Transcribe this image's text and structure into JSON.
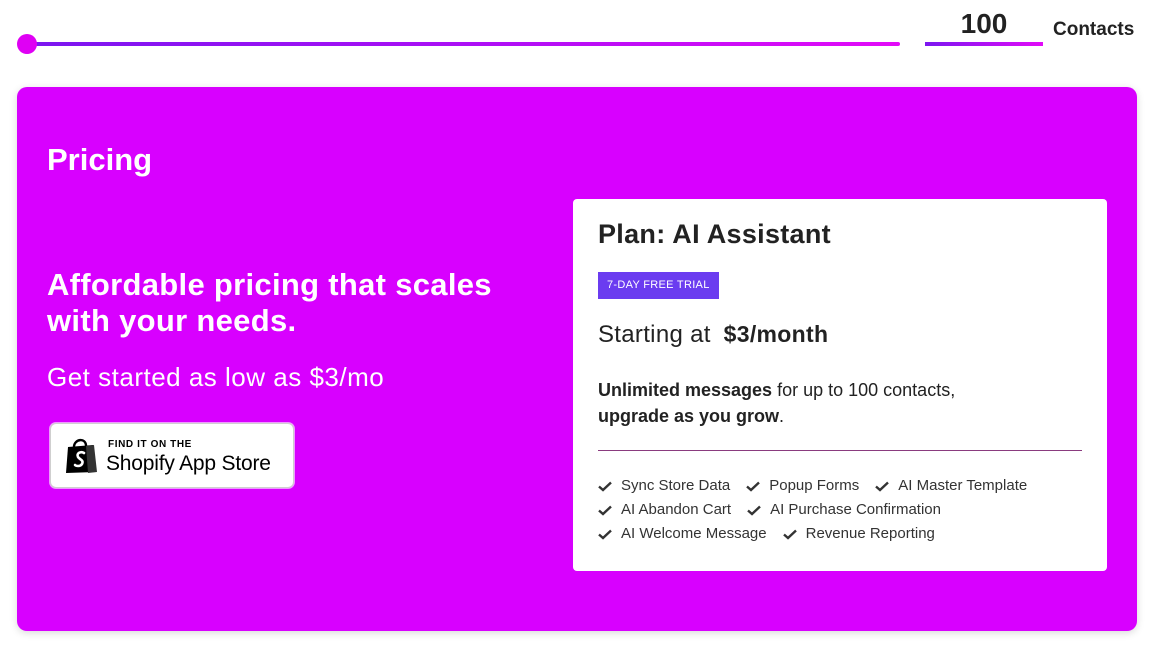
{
  "slider": {
    "value": 100,
    "value_text": "100",
    "unit_label": "Contacts",
    "fill_fraction": 0.0,
    "accent_start": "#7a16f0",
    "accent_end": "#e30af8"
  },
  "pricing": {
    "title": "Pricing",
    "headline": "Affordable pricing that scales with your needs.",
    "subline": "Get started as low as $3/mo",
    "background": "#d800ff",
    "store_badge": {
      "icon": "shopping-bag-icon",
      "small_text": "FIND IT ON THE",
      "large_text": "Shopify App Store"
    }
  },
  "plan": {
    "title": "Plan: AI Assistant",
    "badge": "7-DAY FREE TRIAL",
    "badge_color": "#6b3cf0",
    "starting_label": "Starting at",
    "price": "$3/month",
    "desc_bold_1": "Unlimited messages",
    "desc_text_1": " for up to 100 contacts,",
    "desc_bold_2": "upgrade as you grow",
    "desc_text_2": ".",
    "features": [
      [
        "Sync Store Data",
        "Popup Forms",
        "AI Master Template"
      ],
      [
        "AI Abandon Cart",
        "AI Purchase Confirmation"
      ],
      [
        "AI Welcome Message",
        "Revenue Reporting"
      ]
    ]
  }
}
